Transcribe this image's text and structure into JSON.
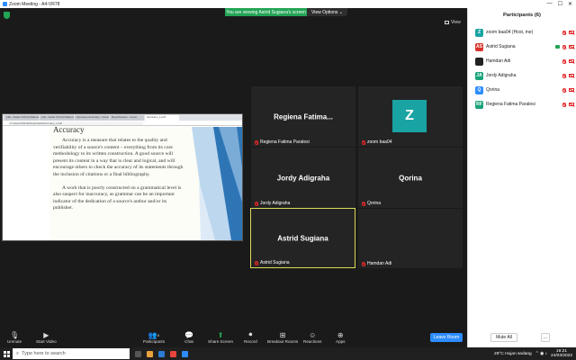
{
  "window": {
    "title": "Zoom Meeting - A4-VR78",
    "controls": [
      "—",
      "☐",
      "✕"
    ]
  },
  "banner": {
    "message": "You are viewing Astrid Sugiana's screen",
    "options_label": "View Options ⌄"
  },
  "view_label": "View",
  "shared_screen": {
    "browser_tabs": [
      "Lab - Kelas 3 Prodi Matematika",
      "Lab - Kelas 3 Prodi Matematika",
      "Accuracy-Accuracy - Cover",
      "Reverbseiten - Cover",
      "Accuracy_1.pdf"
    ],
    "url": "C:/Users/ASUS/Downloads/Accuracy_1.pdf",
    "heading": "Accuracy",
    "paragraphs": [
      "Accuracy is a measure that relates to the quality and verifiability of a source's content – everything from its core methodology to its written construction. A good source will present its content in a way that is clear and logical, and will encourage others to check the accuracy of its statements through the inclusion of citations or a final bibliography.",
      "A work that is poorly constructed on a grammatical level is also suspect for inaccuracy, as grammar can be an important indicator of the dedication of a source's author and/or its publisher."
    ]
  },
  "tiles": [
    {
      "center_name": "Regiena  Fatima...",
      "label": "Regiena Fatima Paralesi",
      "avatar": ""
    },
    {
      "center_name": "",
      "label": "zoom baa04",
      "avatar": "Z"
    },
    {
      "center_name": "Jordy Adigraha",
      "label": "Jordy Adigraha",
      "avatar": ""
    },
    {
      "center_name": "Qorina",
      "label": "Qorina",
      "avatar": ""
    },
    {
      "center_name": "Astrid Sugiana",
      "label": "Astrid Sugiana",
      "avatar": ""
    },
    {
      "center_name": "",
      "label": "Hamdan Adi",
      "avatar": ""
    }
  ],
  "toolbar": {
    "unmute": "Unmute",
    "start_video": "Start Video",
    "participants": "Participants",
    "participants_count": "6",
    "chat": "Chat",
    "share": "Share Screen",
    "record": "Record",
    "breakout": "Breakout Rooms",
    "reactions": "Reactions",
    "apps": "Apps",
    "leave": "Leave Room"
  },
  "panel": {
    "title": "Participants (6)",
    "participants": [
      {
        "initials": "Z",
        "color": "#1aa3a3",
        "name": "zoom baa04 (Host, me)",
        "sharing": false
      },
      {
        "initials": "AS",
        "color": "#d9342b",
        "name": "Astrid Sugiana",
        "sharing": true
      },
      {
        "initials": "",
        "color": "#222222",
        "name": "Hamdan Adi",
        "sharing": false
      },
      {
        "initials": "JA",
        "color": "#1aa37a",
        "name": "Jordy Adigraha",
        "sharing": false
      },
      {
        "initials": "Q",
        "color": "#2d8cff",
        "name": "Qorina",
        "sharing": false
      },
      {
        "initials": "RF",
        "color": "#1aa37a",
        "name": "Regiena Fatima Paralesi",
        "sharing": false
      }
    ],
    "mute_all": "Mute All",
    "more": "..."
  },
  "taskbar": {
    "search_placeholder": "Type here to search",
    "weather": "29°C  Hujan sedang",
    "time": "19:21",
    "date": "24/03/2022"
  }
}
